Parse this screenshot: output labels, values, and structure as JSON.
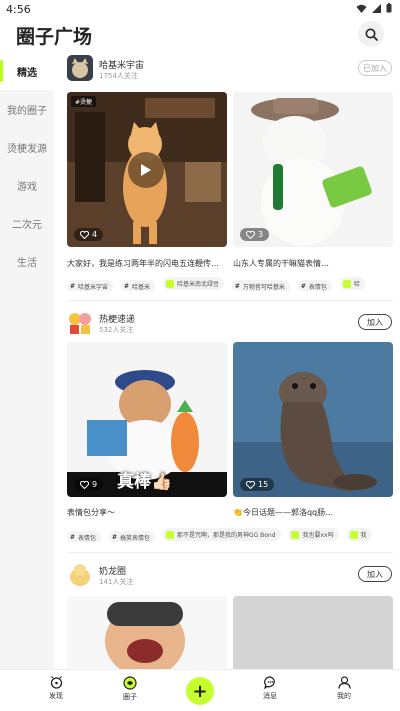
{
  "status_bar": {
    "time": "4:56"
  },
  "header": {
    "title": "圈子广场"
  },
  "sidebar": {
    "items": [
      {
        "label": "精选",
        "active": true
      },
      {
        "label": "我的圈子"
      },
      {
        "label": "烫梗发源"
      },
      {
        "label": "游戏"
      },
      {
        "label": "二次元"
      },
      {
        "label": "生活"
      }
    ]
  },
  "circles": [
    {
      "name": "哈基米宇宙",
      "followers": "1754人关注",
      "join_label": "已加入",
      "joined": true,
      "cards": [
        {
          "badge": "#烫梗",
          "likes": "4",
          "caption": "大家好，我是练习两年半的闪电五连鞭传…",
          "icon": "cat-cafe-photo"
        },
        {
          "likes": "3",
          "caption": "山东人专属的干嘛猫表情…",
          "icon": "cowboy-cat-photo"
        }
      ],
      "tags": [
        {
          "text": "哈基米宇宙",
          "type": "hash"
        },
        {
          "text": "哈基米",
          "type": "hash"
        },
        {
          "text": "哈基米南北绿豆",
          "type": "pill"
        },
        {
          "text": "万物皆可哈基米",
          "type": "hash"
        },
        {
          "text": "表情包",
          "type": "hash"
        },
        {
          "text": "哈",
          "type": "pill"
        }
      ]
    },
    {
      "name": "热梗速递",
      "followers": "532人关注",
      "join_label": "加入",
      "joined": false,
      "cards": [
        {
          "likes": "9",
          "caption": "表情包分享～",
          "overlay": "真棒👍🏻",
          "icon": "police-cat-photo"
        },
        {
          "likes": "15",
          "caption": "👏今日话题——郭洛qq肠…",
          "icon": "sea-lion-photo"
        }
      ],
      "tags": [
        {
          "text": "表情包",
          "type": "hash"
        },
        {
          "text": "搞笑表情包",
          "type": "hash"
        },
        {
          "text": "那不是咒啊，那是我的男神GG Bond",
          "type": "pill"
        },
        {
          "text": "我也要xx吗",
          "type": "pill"
        },
        {
          "text": "我",
          "type": "pill"
        }
      ]
    },
    {
      "name": "奶龙圈",
      "followers": "141人关注",
      "join_label": "加入",
      "joined": false,
      "cards": [
        {
          "icon": "cartoon-character-image"
        },
        {
          "icon": "image-placeholder"
        }
      ]
    }
  ],
  "tabbar": {
    "items": [
      {
        "label": "发现",
        "icon": "discover-icon"
      },
      {
        "label": "圈子",
        "icon": "circle-icon",
        "active": true
      },
      {
        "label": "+",
        "icon": "plus-icon"
      },
      {
        "label": "消息",
        "icon": "message-icon"
      },
      {
        "label": "我的",
        "icon": "profile-icon"
      }
    ]
  },
  "colors": {
    "accent": "#c6ff2e",
    "sidebar_bg": "#f5f5f5"
  }
}
